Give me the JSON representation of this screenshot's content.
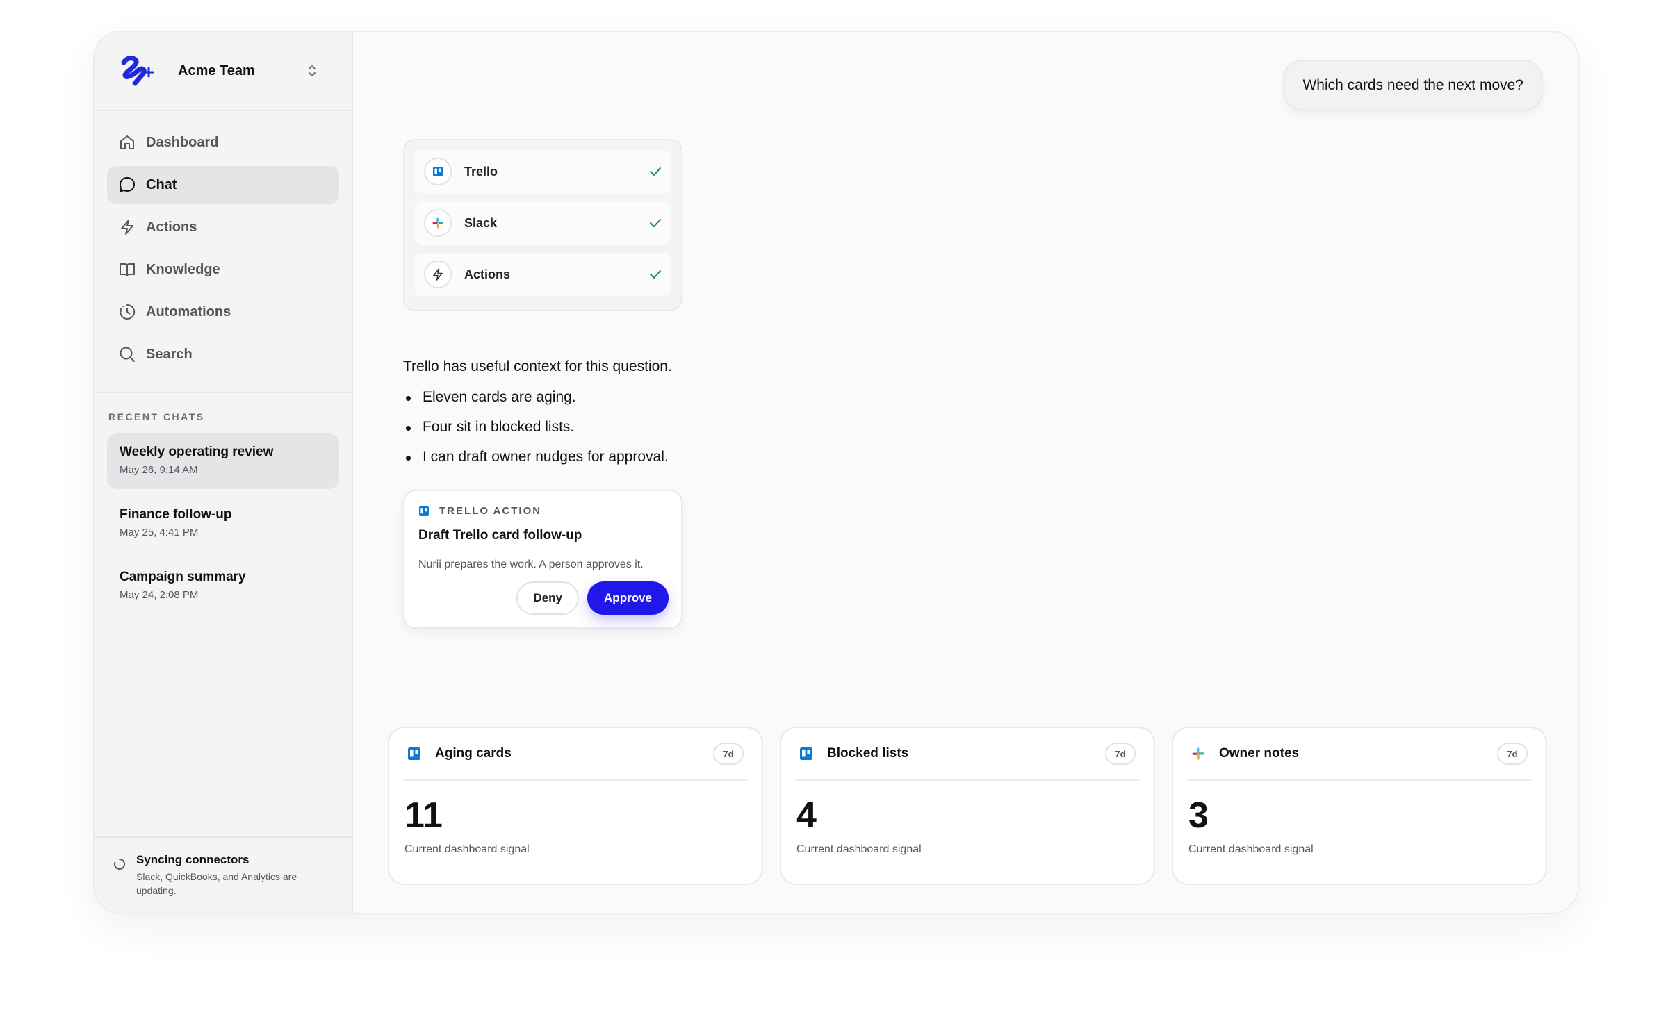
{
  "team": {
    "name": "Acme Team"
  },
  "nav": [
    {
      "label": "Dashboard",
      "icon": "home-icon",
      "active": false
    },
    {
      "label": "Chat",
      "icon": "chat-icon",
      "active": true
    },
    {
      "label": "Actions",
      "icon": "bolt-icon",
      "active": false
    },
    {
      "label": "Knowledge",
      "icon": "book-icon",
      "active": false
    },
    {
      "label": "Automations",
      "icon": "clock-icon",
      "active": false
    },
    {
      "label": "Search",
      "icon": "search-icon",
      "active": false
    }
  ],
  "recent": {
    "heading": "RECENT CHATS",
    "items": [
      {
        "title": "Weekly operating review",
        "date": "May 26, 9:14 AM",
        "active": true
      },
      {
        "title": "Finance follow-up",
        "date": "May 25, 4:41 PM",
        "active": false
      },
      {
        "title": "Campaign summary",
        "date": "May 24, 2:08 PM",
        "active": false
      }
    ]
  },
  "sync": {
    "title": "Syncing connectors",
    "description": "Slack, QuickBooks, and Analytics are updating."
  },
  "chat": {
    "user_message": "Which cards need the next move?",
    "tools": [
      {
        "name": "Trello",
        "icon": "trello-icon",
        "status": "done"
      },
      {
        "name": "Slack",
        "icon": "slack-icon",
        "status": "done"
      },
      {
        "name": "Actions",
        "icon": "bolt-icon",
        "status": "done"
      }
    ],
    "answer_lead": "Trello has useful context for this question.",
    "answer_points": [
      "Eleven cards are aging.",
      "Four sit in blocked lists.",
      "I can draft owner nudges for approval."
    ],
    "action_card": {
      "kicker": "TRELLO ACTION",
      "title": "Draft Trello card follow-up",
      "description": "Nurii prepares the work. A person approves it.",
      "deny_label": "Deny",
      "approve_label": "Approve"
    }
  },
  "stats": [
    {
      "title": "Aging cards",
      "icon": "trello-icon",
      "badge": "7d",
      "value": "11",
      "caption": "Current dashboard signal"
    },
    {
      "title": "Blocked lists",
      "icon": "trello-icon",
      "badge": "7d",
      "value": "4",
      "caption": "Current dashboard signal"
    },
    {
      "title": "Owner notes",
      "icon": "slack-icon",
      "badge": "7d",
      "value": "3",
      "caption": "Current dashboard signal"
    }
  ],
  "colors": {
    "accent": "#2017e8",
    "brand_logo": "#1f2bd8",
    "trello": "#0c7bd5",
    "check": "#1f8a4c"
  }
}
